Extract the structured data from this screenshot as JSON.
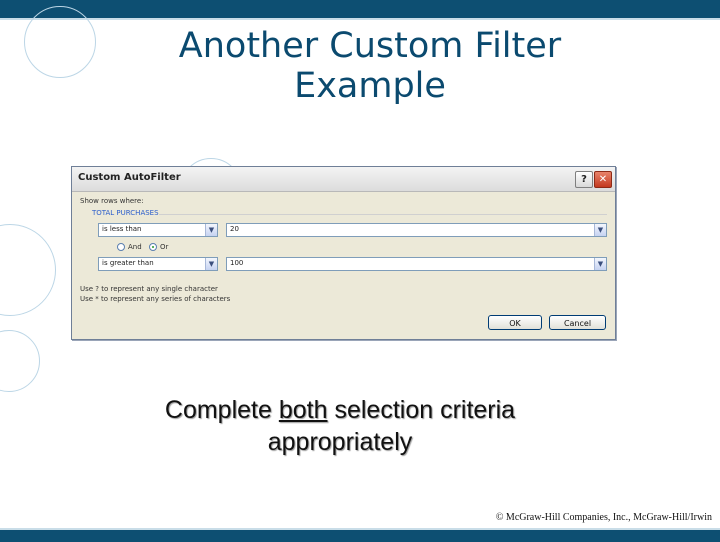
{
  "title": {
    "line1": "Another Custom Filter",
    "line2": "Example"
  },
  "dialog": {
    "title": "Custom AutoFilter",
    "help_label": "?",
    "close_label": "✕",
    "show_rows_label": "Show rows where:",
    "field_name": "TOTAL PURCHASES",
    "criteria1": {
      "operator": "is less than",
      "value": "20"
    },
    "logic": {
      "and_label": "And",
      "or_label": "Or",
      "selected": "Or"
    },
    "criteria2": {
      "operator": "is greater than",
      "value": "100"
    },
    "hint1": "Use ? to represent any single character",
    "hint2": "Use * to represent any series of characters",
    "ok_label": "OK",
    "cancel_label": "Cancel"
  },
  "caption": {
    "pre": "Complete ",
    "underlined": "both",
    "post": " selection criteria",
    "line2": "appropriately"
  },
  "copyright": "© McGraw-Hill Companies, Inc., McGraw-Hill/Irwin",
  "colors": {
    "bar": "#0d4f72",
    "title": "#0b4a6f",
    "dialog_bg": "#ece9d8"
  }
}
